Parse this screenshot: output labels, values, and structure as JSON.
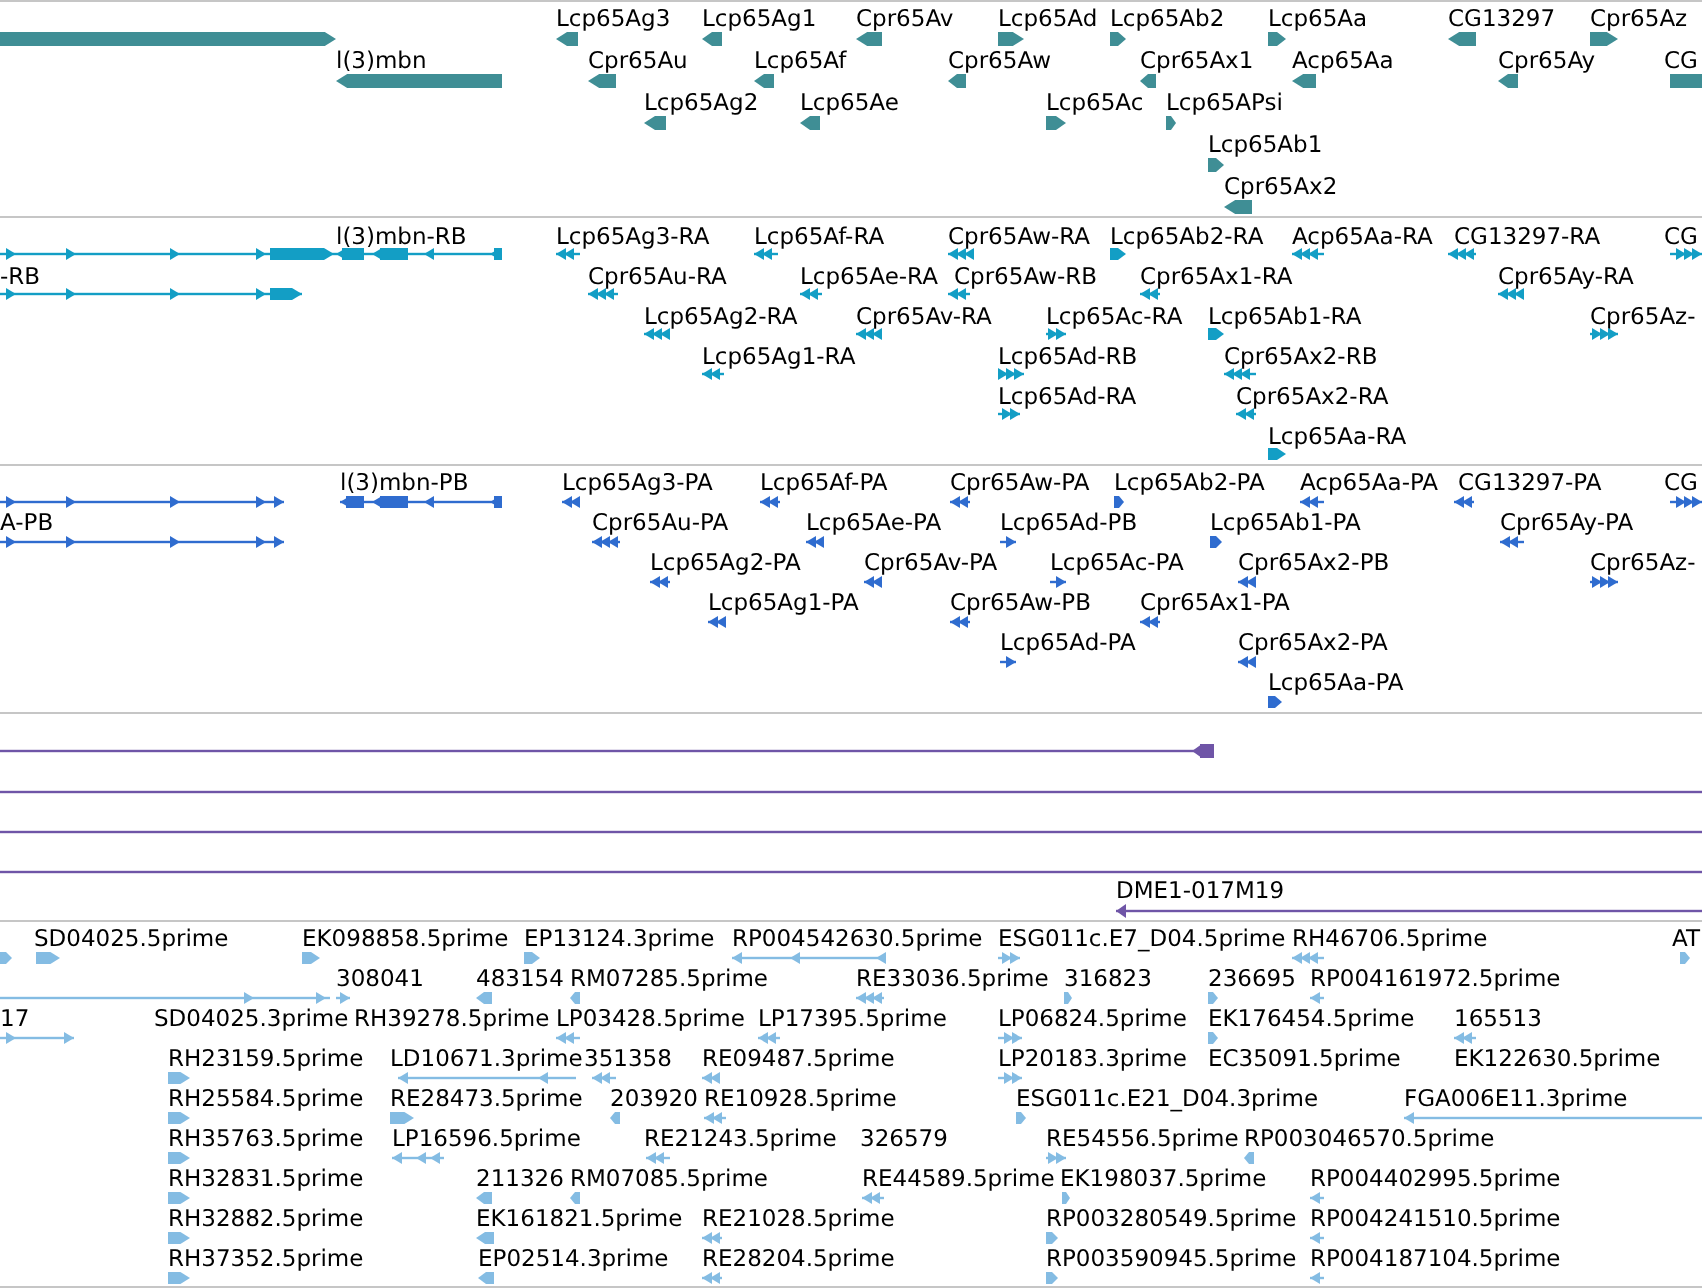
{
  "tracks": [
    {
      "kind": "gene",
      "features": [
        {
          "kind": "arrow",
          "reverse": false
        },
        {
          "label": "Lcp65Ag3",
          "kind": "arrow",
          "reverse": true
        },
        {
          "label": "Lcp65Ag1",
          "kind": "arrow",
          "reverse": true
        },
        {
          "label": "Cpr65Av",
          "kind": "arrow",
          "reverse": true
        },
        {
          "label": "Lcp65Ad",
          "kind": "arrow",
          "reverse": false
        },
        {
          "label": "Lcp65Ab2",
          "kind": "arrow",
          "reverse": false
        },
        {
          "label": "Lcp65Aa",
          "kind": "arrow",
          "reverse": false
        },
        {
          "label": "CG13297",
          "kind": "arrow",
          "reverse": true
        },
        {
          "label": "Cpr65Az",
          "kind": "arrow",
          "reverse": false
        },
        {
          "label": "l(3)mbn",
          "kind": "arrow",
          "reverse": true
        },
        {
          "label": "Cpr65Au",
          "kind": "arrow",
          "reverse": true
        },
        {
          "label": "Lcp65Af",
          "kind": "arrow",
          "reverse": true
        },
        {
          "label": "Cpr65Aw",
          "kind": "arrow",
          "reverse": true
        },
        {
          "label": "Cpr65Ax1",
          "kind": "arrow",
          "reverse": true
        },
        {
          "label": "Acp65Aa",
          "kind": "arrow",
          "reverse": true
        },
        {
          "label": "Cpr65Ay",
          "kind": "arrow",
          "reverse": true
        },
        {
          "label": "CG",
          "kind": "arrow"
        },
        {
          "label": "Lcp65Ag2",
          "kind": "arrow",
          "reverse": true
        },
        {
          "label": "Lcp65Ae",
          "kind": "arrow",
          "reverse": true
        },
        {
          "label": "Lcp65Ac",
          "kind": "arrow",
          "reverse": false
        },
        {
          "label": "Lcp65APsi",
          "kind": "arrow",
          "reverse": false
        },
        {
          "label": "Lcp65Ab1",
          "kind": "arrow",
          "reverse": false
        },
        {
          "label": "Cpr65Ax2",
          "kind": "arrow",
          "reverse": true
        }
      ]
    },
    {
      "kind": "mrna",
      "features": [
        {
          "kind": "segments",
          "reverse": false
        },
        {
          "label": "l(3)mbn-RB",
          "kind": "segments",
          "reverse": true
        },
        {
          "label": "Lcp65Ag3-RA",
          "kind": "chevrons",
          "reverse": true
        },
        {
          "label": "Lcp65Af-RA",
          "kind": "chevrons",
          "reverse": true
        },
        {
          "label": "Cpr65Aw-RA",
          "kind": "chevrons",
          "reverse": true
        },
        {
          "label": "Lcp65Ab2-RA",
          "kind": "arrow",
          "reverse": false
        },
        {
          "label": "Acp65Aa-RA",
          "kind": "chevrons",
          "reverse": true
        },
        {
          "label": "CG13297-RA",
          "kind": "chevrons",
          "reverse": true
        },
        {
          "label": "CG",
          "kind": "chevrons",
          "reverse": false
        },
        {
          "label": "-RB",
          "kind": "segments",
          "reverse": false
        },
        {
          "label": "Cpr65Au-RA",
          "kind": "chevrons",
          "reverse": true
        },
        {
          "label": "Lcp65Ae-RA",
          "kind": "chevrons",
          "reverse": true
        },
        {
          "label": "Cpr65Aw-RB",
          "kind": "chevrons",
          "reverse": true
        },
        {
          "label": "Cpr65Ax1-RA",
          "kind": "chevrons",
          "reverse": true
        },
        {
          "label": "Cpr65Ay-RA",
          "kind": "chevrons",
          "reverse": true
        },
        {
          "label": "Lcp65Ag2-RA",
          "kind": "chevrons",
          "reverse": true
        },
        {
          "label": "Cpr65Av-RA",
          "kind": "chevrons",
          "reverse": true
        },
        {
          "label": "Lcp65Ac-RA",
          "kind": "chevrons",
          "reverse": false
        },
        {
          "label": "Lcp65Ab1-RA",
          "kind": "arrow",
          "reverse": false
        },
        {
          "label": "Cpr65Az-",
          "kind": "chevrons",
          "reverse": false
        },
        {
          "label": "Lcp65Ag1-RA",
          "kind": "chevrons",
          "reverse": true
        },
        {
          "label": "Lcp65Ad-RB",
          "kind": "chevrons",
          "reverse": false
        },
        {
          "label": "Cpr65Ax2-RB",
          "kind": "chevrons",
          "reverse": true
        },
        {
          "label": "Lcp65Ad-RA",
          "kind": "chevrons",
          "reverse": false
        },
        {
          "label": "Cpr65Ax2-RA",
          "kind": "chevrons",
          "reverse": true
        },
        {
          "label": "Lcp65Aa-RA",
          "kind": "arrow",
          "reverse": false
        }
      ]
    },
    {
      "kind": "protein",
      "features": [
        {
          "kind": "segments",
          "reverse": false
        },
        {
          "label": "l(3)mbn-PB",
          "kind": "segments",
          "reverse": true
        },
        {
          "label": "Lcp65Ag3-PA",
          "kind": "chevrons",
          "reverse": true
        },
        {
          "label": "Lcp65Af-PA",
          "kind": "chevrons",
          "reverse": true
        },
        {
          "label": "Cpr65Aw-PA",
          "kind": "chevrons",
          "reverse": true
        },
        {
          "label": "Lcp65Ab2-PA",
          "kind": "arrow",
          "reverse": false
        },
        {
          "label": "Acp65Aa-PA",
          "kind": "chevrons",
          "reverse": true
        },
        {
          "label": "CG13297-PA",
          "kind": "chevrons",
          "reverse": true
        },
        {
          "label": "CG",
          "kind": "chevrons",
          "reverse": false
        },
        {
          "label": "A-PB",
          "kind": "segments",
          "reverse": false
        },
        {
          "label": "Cpr65Au-PA",
          "kind": "chevrons",
          "reverse": true
        },
        {
          "label": "Lcp65Ae-PA",
          "kind": "chevrons",
          "reverse": true
        },
        {
          "label": "Lcp65Ad-PB",
          "kind": "chevrons",
          "reverse": false
        },
        {
          "label": "Lcp65Ab1-PA",
          "kind": "arrow",
          "reverse": false
        },
        {
          "label": "Cpr65Ay-PA",
          "kind": "chevrons",
          "reverse": true
        },
        {
          "label": "Lcp65Ag2-PA",
          "kind": "chevrons",
          "reverse": true
        },
        {
          "label": "Cpr65Av-PA",
          "kind": "chevrons",
          "reverse": true
        },
        {
          "label": "Lcp65Ac-PA",
          "kind": "chevrons",
          "reverse": false
        },
        {
          "label": "Cpr65Ax2-PB",
          "kind": "chevrons",
          "reverse": true
        },
        {
          "label": "Cpr65Az-",
          "kind": "chevrons",
          "reverse": false
        },
        {
          "label": "Lcp65Ag1-PA",
          "kind": "chevrons",
          "reverse": true
        },
        {
          "label": "Cpr65Aw-PB",
          "kind": "chevrons",
          "reverse": true
        },
        {
          "label": "Cpr65Ax1-PA",
          "kind": "chevrons",
          "reverse": true
        },
        {
          "label": "Lcp65Ad-PA",
          "kind": "chevrons",
          "reverse": false
        },
        {
          "label": "Cpr65Ax2-PA",
          "kind": "chevrons",
          "reverse": true
        },
        {
          "label": "Lcp65Aa-PA",
          "kind": "arrow",
          "reverse": false
        }
      ]
    },
    {
      "kind": "clone",
      "features": [
        {
          "kind": "segments",
          "reverse": true
        },
        {
          "kind": "line"
        },
        {
          "kind": "line"
        },
        {
          "kind": "line"
        },
        {
          "label": "DME1-017M19",
          "kind": "segments",
          "reverse": true
        }
      ]
    },
    {
      "kind": "est",
      "features": [
        {
          "kind": "arrow",
          "reverse": false
        },
        {
          "label": "SD04025.5prime",
          "kind": "arrow",
          "reverse": false
        },
        {
          "label": "EK098858.5prime",
          "kind": "arrow",
          "reverse": false
        },
        {
          "label": "EP13124.3prime",
          "kind": "arrow",
          "reverse": false
        },
        {
          "label": "RP004542630.5prime",
          "kind": "segments",
          "reverse": true
        },
        {
          "label": "ESG011c.E7_D04.5prime",
          "kind": "chevrons",
          "reverse": false
        },
        {
          "label": "RH46706.5prime",
          "kind": "chevrons",
          "reverse": true
        },
        {
          "label": "AT",
          "kind": "arrow",
          "reverse": false
        },
        {
          "kind": "segments",
          "reverse": false
        },
        {
          "label": "308041",
          "kind": "chevrons",
          "reverse": false
        },
        {
          "label": "483154",
          "kind": "arrow",
          "reverse": true
        },
        {
          "label": "RM07285.5prime",
          "kind": "arrow",
          "reverse": true
        },
        {
          "label": "RE33036.5prime",
          "kind": "chevrons",
          "reverse": true
        },
        {
          "label": "316823",
          "kind": "arrow",
          "reverse": false
        },
        {
          "label": "236695",
          "kind": "arrow",
          "reverse": false
        },
        {
          "label": "RP004161972.5prime",
          "kind": "chevrons",
          "reverse": true
        },
        {
          "label": "17",
          "kind": "segments",
          "reverse": false
        },
        {
          "label": "SD04025.3prime"
        },
        {
          "label": "RH39278.5prime"
        },
        {
          "label": "LP03428.5prime",
          "kind": "chevrons",
          "reverse": true
        },
        {
          "label": "LP17395.5prime",
          "kind": "chevrons",
          "reverse": true
        },
        {
          "label": "LP06824.5prime",
          "kind": "chevrons",
          "reverse": false
        },
        {
          "label": "EK176454.5prime",
          "kind": "arrow",
          "reverse": false
        },
        {
          "label": "165513",
          "kind": "chevrons",
          "reverse": true
        },
        {
          "label": "RH23159.5prime",
          "kind": "arrow",
          "reverse": false
        },
        {
          "label": "LD10671.3prime",
          "kind": "segments",
          "reverse": true
        },
        {
          "label": "351358",
          "kind": "chevrons",
          "reverse": true
        },
        {
          "label": "RE09487.5prime",
          "kind": "chevrons",
          "reverse": true
        },
        {
          "label": "LP20183.3prime",
          "kind": "chevrons",
          "reverse": false
        },
        {
          "label": "EC35091.5prime"
        },
        {
          "label": "EK122630.5prime"
        },
        {
          "label": "RH25584.5prime",
          "kind": "arrow",
          "reverse": false
        },
        {
          "label": "RE28473.5prime",
          "kind": "arrow",
          "reverse": false
        },
        {
          "label": "203920",
          "kind": "arrow",
          "reverse": true
        },
        {
          "label": "RE10928.5prime",
          "kind": "chevrons",
          "reverse": true
        },
        {
          "label": "ESG011c.E21_D04.3prime",
          "kind": "arrow",
          "reverse": false
        },
        {
          "label": "FGA006E11.3prime",
          "kind": "segments",
          "reverse": true
        },
        {
          "label": "RH35763.5prime",
          "kind": "arrow",
          "reverse": false
        },
        {
          "label": "LP16596.5prime",
          "kind": "segments",
          "reverse": true
        },
        {
          "label": "RE21243.5prime",
          "kind": "chevrons",
          "reverse": true
        },
        {
          "label": "326579"
        },
        {
          "label": "RE54556.5prime",
          "kind": "chevrons",
          "reverse": false
        },
        {
          "label": "RP003046570.5prime",
          "kind": "arrow",
          "reverse": true
        },
        {
          "label": "RH32831.5prime",
          "kind": "arrow",
          "reverse": false
        },
        {
          "label": "211326",
          "kind": "arrow",
          "reverse": true
        },
        {
          "label": "RM07085.5prime",
          "kind": "arrow",
          "reverse": true
        },
        {
          "label": "RE44589.5prime",
          "kind": "chevrons",
          "reverse": true
        },
        {
          "label": "EK198037.5prime",
          "kind": "arrow",
          "reverse": false
        },
        {
          "label": "RP004402995.5prime",
          "kind": "chevrons",
          "reverse": true
        },
        {
          "label": "RH32882.5prime",
          "kind": "arrow",
          "reverse": false
        },
        {
          "label": "EK161821.5prime",
          "kind": "arrow",
          "reverse": true
        },
        {
          "label": "RE21028.5prime",
          "kind": "chevrons",
          "reverse": true
        },
        {
          "label": "RP003280549.5prime",
          "kind": "arrow",
          "reverse": false
        },
        {
          "label": "RP004241510.5prime",
          "kind": "chevrons",
          "reverse": true
        },
        {
          "label": "RH37352.5prime",
          "kind": "arrow",
          "reverse": false
        },
        {
          "label": "EP02514.3prime",
          "kind": "arrow",
          "reverse": true
        },
        {
          "label": "RE28204.5prime",
          "kind": "chevrons",
          "reverse": true
        },
        {
          "label": "RP003590945.5prime",
          "kind": "arrow",
          "reverse": false
        },
        {
          "label": "RP004187104.5prime",
          "kind": "chevrons",
          "reverse": true
        }
      ]
    }
  ]
}
